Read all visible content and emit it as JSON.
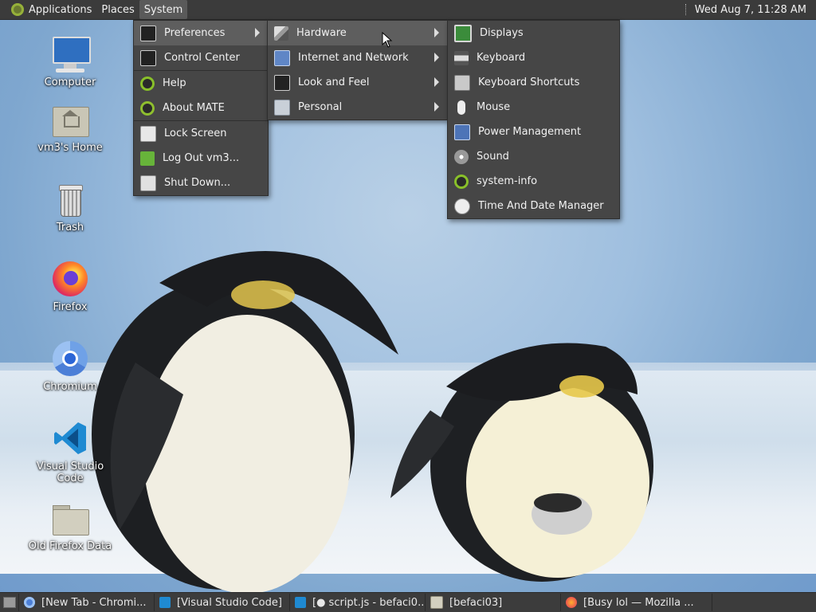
{
  "top_panel": {
    "applications": "Applications",
    "places": "Places",
    "system": "System",
    "clock": "Wed Aug  7, 11:28 AM"
  },
  "desktop_icons": [
    {
      "label": "Computer",
      "icon": "computer-icon"
    },
    {
      "label": "vm3's Home",
      "icon": "home-folder-icon"
    },
    {
      "label": "Trash",
      "icon": "trash-icon"
    },
    {
      "label": "Firefox",
      "icon": "firefox-icon"
    },
    {
      "label": "Chromium",
      "icon": "chromium-icon"
    },
    {
      "label": "Visual Studio Code",
      "icon": "vscode-icon"
    },
    {
      "label": "Old Firefox Data",
      "icon": "folder-icon"
    }
  ],
  "system_menu": {
    "items": [
      {
        "label": "Preferences",
        "icon": "preferences-icon",
        "submenu": true
      },
      {
        "label": "Control Center",
        "icon": "control-center-icon"
      },
      {
        "label": "Help",
        "icon": "help-icon"
      },
      {
        "label": "About MATE",
        "icon": "mate-icon"
      },
      {
        "label": "Lock Screen",
        "icon": "lock-icon"
      },
      {
        "label": "Log Out vm3...",
        "icon": "logout-icon"
      },
      {
        "label": "Shut Down...",
        "icon": "shutdown-icon"
      }
    ]
  },
  "preferences_menu": {
    "items": [
      {
        "label": "Hardware",
        "icon": "hardware-icon",
        "submenu": true
      },
      {
        "label": "Internet and Network",
        "icon": "network-icon",
        "submenu": true
      },
      {
        "label": "Look and Feel",
        "icon": "look-and-feel-icon",
        "submenu": true
      },
      {
        "label": "Personal",
        "icon": "personal-icon",
        "submenu": true
      }
    ]
  },
  "hardware_menu": {
    "items": [
      {
        "label": "Displays",
        "icon": "displays-icon"
      },
      {
        "label": "Keyboard",
        "icon": "keyboard-icon"
      },
      {
        "label": "Keyboard Shortcuts",
        "icon": "keyboard-shortcuts-icon"
      },
      {
        "label": "Mouse",
        "icon": "mouse-icon"
      },
      {
        "label": "Power Management",
        "icon": "power-management-icon"
      },
      {
        "label": "Sound",
        "icon": "sound-icon"
      },
      {
        "label": "system-info",
        "icon": "system-info-icon"
      },
      {
        "label": "Time And Date Manager",
        "icon": "clock-icon"
      }
    ]
  },
  "taskbar": {
    "windows": [
      {
        "label": "[New Tab - Chromi...",
        "icon": "chromium-icon"
      },
      {
        "label": "[Visual Studio Code]",
        "icon": "vscode-icon"
      },
      {
        "label": "[● script.js - befaci0...",
        "icon": "vscode-icon"
      },
      {
        "label": "[befaci03]",
        "icon": "folder-icon"
      },
      {
        "label": "[Busy lol — Mozilla ...",
        "icon": "firefox-icon"
      }
    ]
  }
}
